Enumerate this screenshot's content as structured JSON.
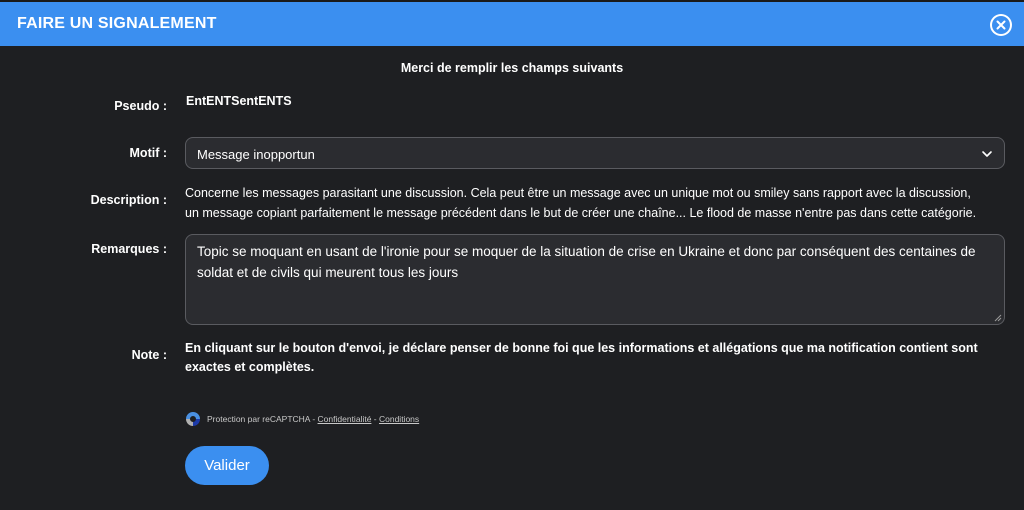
{
  "header": {
    "title": "FAIRE UN SIGNALEMENT",
    "close_icon": "close-icon"
  },
  "intro": "Merci de remplir les champs suivants",
  "fields": {
    "pseudo": {
      "label": "Pseudo :",
      "value": "EntENTSentENTS"
    },
    "motif": {
      "label": "Motif :",
      "selected": "Message inopportun"
    },
    "description": {
      "label": "Description :",
      "text": "Concerne les messages parasitant une discussion. Cela peut être un message avec un unique mot ou smiley sans rapport avec la discussion, un message copiant parfaitement le message précédent dans le but de créer une chaîne... Le flood de masse n'entre pas dans cette catégorie."
    },
    "remarques": {
      "label": "Remarques :",
      "value": "Topic se moquant en usant de l'ironie pour se moquer de la situation de crise en Ukraine et donc par conséquent des centaines de soldat et de civils qui meurent tous les jours"
    },
    "note": {
      "label": "Note :",
      "text": "En cliquant sur le bouton d'envoi, je déclare penser de bonne foi que les informations et allégations que ma notification contient sont exactes et complètes."
    }
  },
  "recaptcha": {
    "prefix": "Protection par reCAPTCHA - ",
    "privacy": "Confidentialité",
    "separator": " - ",
    "terms": "Conditions"
  },
  "submit_label": "Valider",
  "colors": {
    "accent": "#3b8ff0",
    "background": "#1e1f22",
    "field": "#2b2c30"
  }
}
